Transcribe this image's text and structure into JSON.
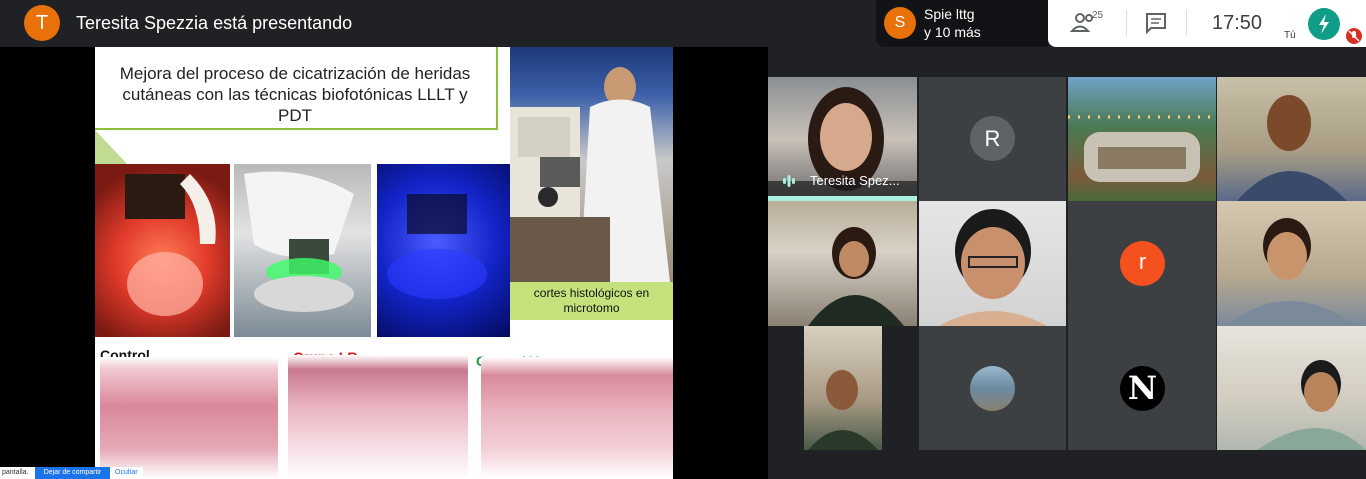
{
  "header": {
    "presenter_initial": "T",
    "presenter_text": "Teresita Spezzia está presentando",
    "others_initial": "S",
    "others_line1": "Spie lttg",
    "others_line2": "y 10 más",
    "participants_count": "25",
    "time": "17:50",
    "self_label": "Tú"
  },
  "slide": {
    "title": "Mejora del proceso de cicatrización de heridas cutáneas con las técnicas biofotónicas LLLT y PDT",
    "caption": "cortes histológicos en microtomo",
    "labels": [
      "Control",
      "Grupo LR",
      "Grupo LV"
    ],
    "label_colors": [
      "#111111",
      "#d0201e",
      "#1f9a3a"
    ]
  },
  "share_bar": {
    "text": "pantalla.",
    "stop_button": "Dejar de compartir",
    "hide_button": "Ocultar"
  },
  "participants": {
    "presenter_name": "Teresita Spez...",
    "initial_r_upper": "R",
    "initial_r_lower": "r",
    "initial_n": "N"
  },
  "colors": {
    "accent_green": "#8cbf3a",
    "avatar_orange": "#e8710a",
    "stop_blue": "#1a73e8",
    "speaking_bar": "#a8f0e0"
  }
}
